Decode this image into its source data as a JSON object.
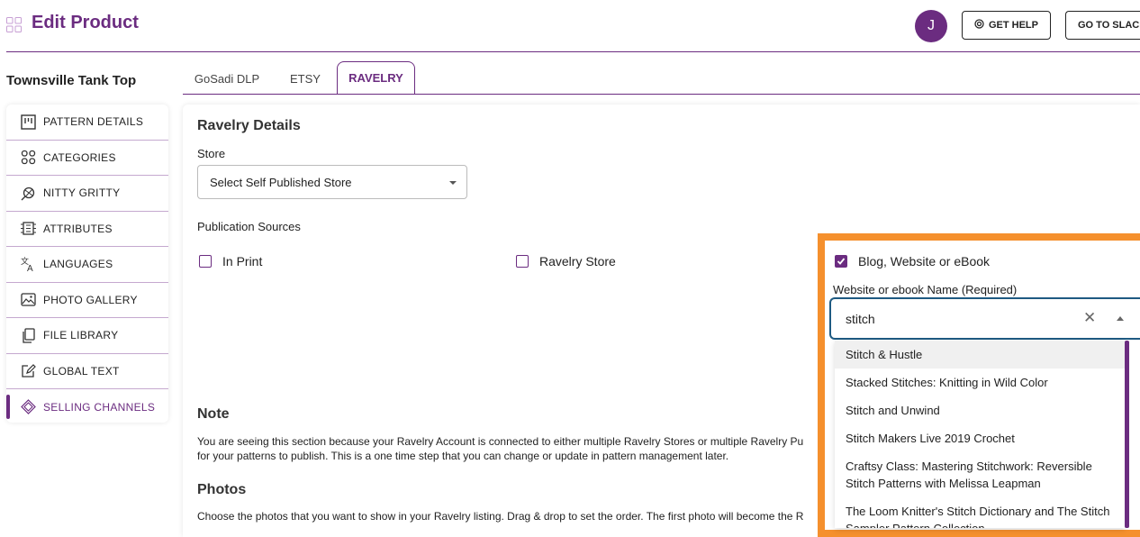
{
  "header": {
    "title": "Edit Product",
    "avatar_initial": "J",
    "help_label": "GET HELP",
    "slack_label": "GO TO SLACK"
  },
  "sidebar": {
    "product_name": "Townsville Tank Top",
    "items": [
      {
        "label": "PATTERN DETAILS",
        "icon": "pattern-icon"
      },
      {
        "label": "CATEGORIES",
        "icon": "categories-icon"
      },
      {
        "label": "NITTY GRITTY",
        "icon": "yarn-icon"
      },
      {
        "label": "ATTRIBUTES",
        "icon": "attributes-icon"
      },
      {
        "label": "LANGUAGES",
        "icon": "translate-icon"
      },
      {
        "label": "PHOTO GALLERY",
        "icon": "photo-icon"
      },
      {
        "label": "FILE LIBRARY",
        "icon": "files-icon"
      },
      {
        "label": "GLOBAL TEXT",
        "icon": "edit-icon"
      },
      {
        "label": "SELLING CHANNELS",
        "icon": "layers-icon",
        "active": true
      }
    ]
  },
  "tabs": [
    {
      "label": "GoSadi DLP"
    },
    {
      "label": "ETSY"
    },
    {
      "label": "RAVELRY",
      "active": true
    }
  ],
  "ravelry": {
    "section_title": "Ravelry Details",
    "store_label": "Store",
    "store_value": "Select Self Published Store",
    "pub_sources_label": "Publication Sources",
    "sources": [
      {
        "label": "In Print",
        "checked": false
      },
      {
        "label": "Ravelry Store",
        "checked": false
      },
      {
        "label": "Blog, Website or eBook",
        "checked": true
      }
    ],
    "ebook_label": "Website or ebook Name (Required)",
    "ebook_value": "stitch",
    "options": [
      "Stitch & Hustle",
      "Stacked Stitches: Knitting in Wild Color",
      "Stitch and Unwind",
      "Stitch Makers Live 2019 Crochet",
      "Craftsy Class: Mastering Stitchwork: Reversible Stitch Patterns with Melissa Leapman",
      "The Loom Knitter's Stitch Dictionary and The Stitch Sampler Pattern Collection"
    ],
    "note_title": "Note",
    "note_line1": "You are seeing this section because your Ravelry Account is connected to either multiple Ravelry Stores or multiple Ravelry Pu",
    "note_line2": "for your patterns to publish. This is a one time step that you can change or update in pattern management later.",
    "photos_title": "Photos",
    "photos_text": "Choose the photos that you want to show in your Ravelry listing. Drag & drop to set the order. The first photo will become the R"
  },
  "colors": {
    "brand": "#6b2c80",
    "highlight": "#f5902d",
    "focus": "#1e5a82"
  }
}
